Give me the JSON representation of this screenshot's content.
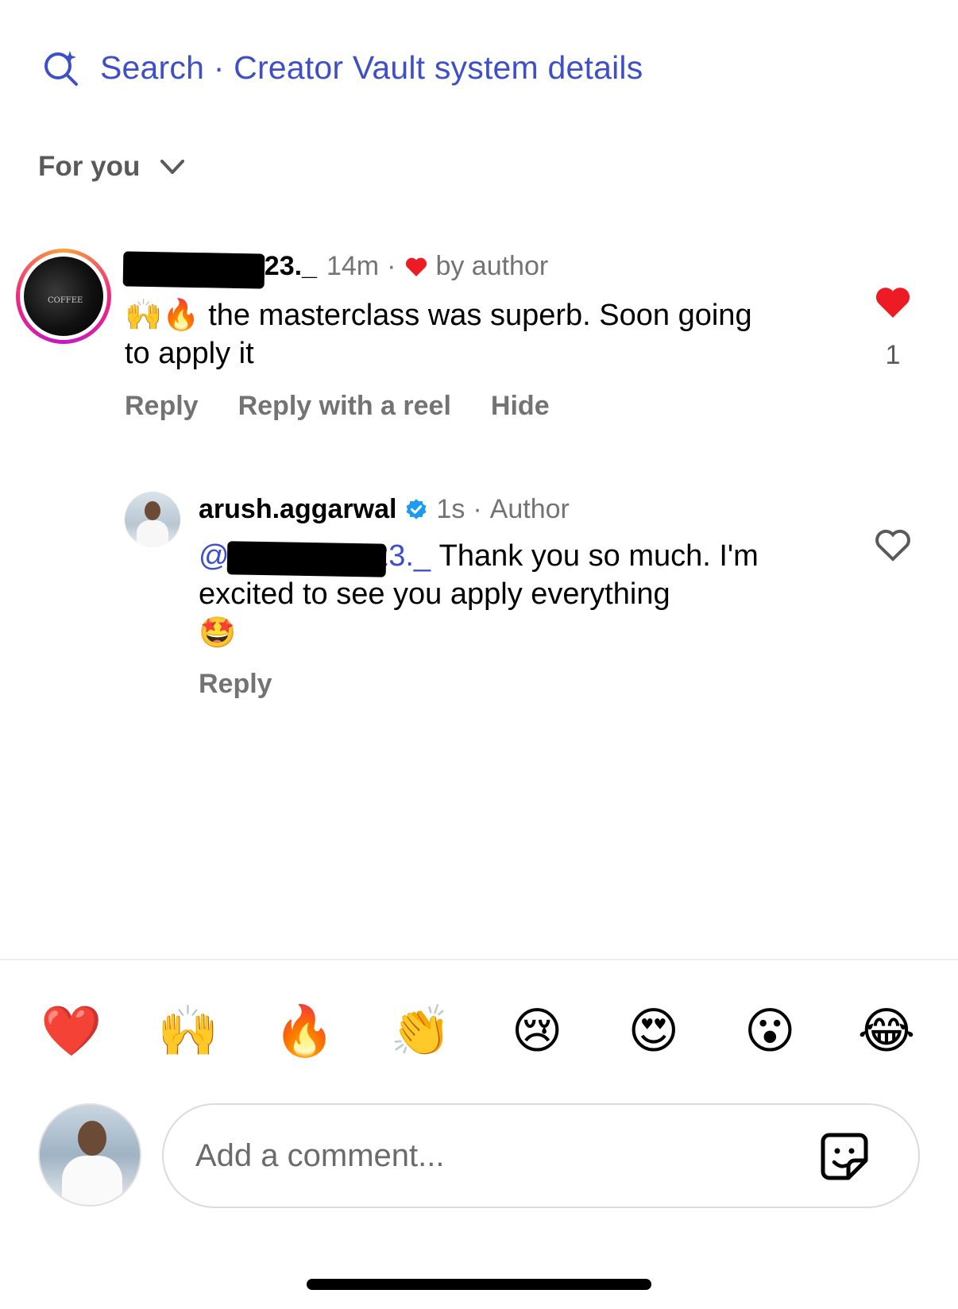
{
  "search": {
    "label": "Search · Creator Vault system details"
  },
  "filter": {
    "label": "For you"
  },
  "comment": {
    "username": "evasinclair23._",
    "time": "14m",
    "liked_by_author": "by author",
    "text_emoji": "🙌🔥",
    "text": "the masterclass was superb. Soon going to apply it",
    "like_count": "1",
    "actions": {
      "reply": "Reply",
      "reply_reel": "Reply with a reel",
      "hide": "Hide"
    }
  },
  "reply": {
    "username": "arush.aggarwal",
    "time": "1s",
    "role": "Author",
    "mention": "@evasinclair23._",
    "text": "Thank you so much. I'm excited to see you apply everything",
    "text_emoji": "🤩",
    "actions": {
      "reply": "Reply"
    }
  },
  "reactions": [
    "❤️",
    "🙌",
    "🔥",
    "👏",
    "😢",
    "😍",
    "😮",
    "😂"
  ],
  "composer": {
    "placeholder": "Add a comment..."
  },
  "colors": {
    "accent": "#3f4fc8",
    "like": "#ed1c24",
    "muted": "#737373"
  },
  "icons": [
    "search-sparkle-icon",
    "chevron-down-icon",
    "heart-filled-icon",
    "heart-outline-icon",
    "verified-badge-icon",
    "sticker-icon"
  ]
}
